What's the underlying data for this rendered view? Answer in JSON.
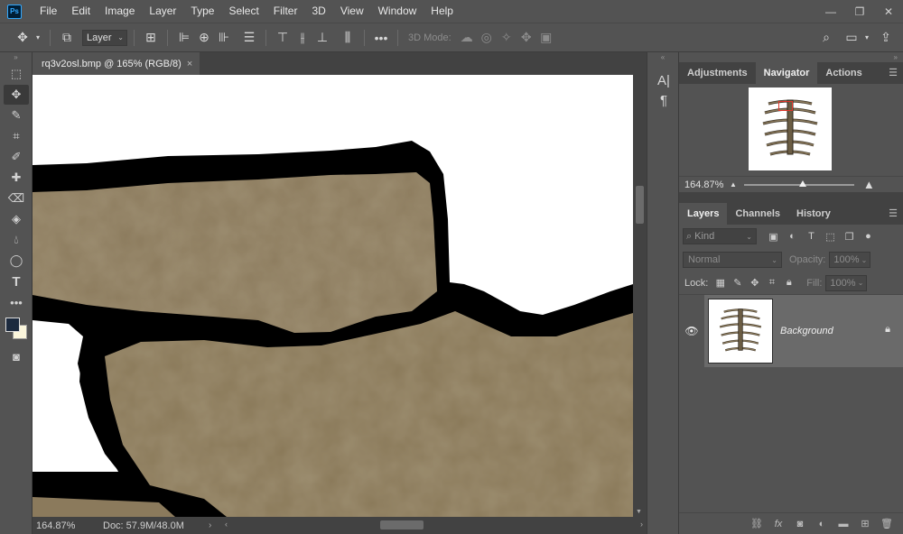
{
  "app": {
    "logo": "Ps"
  },
  "menu": [
    "File",
    "Edit",
    "Image",
    "Layer",
    "Type",
    "Select",
    "Filter",
    "3D",
    "View",
    "Window",
    "Help"
  ],
  "window_controls": {
    "minimize": "—",
    "restore": "❐",
    "close": "✕"
  },
  "options_bar": {
    "auto_select_target": "Layer",
    "mode_3d_label": "3D Mode:"
  },
  "document": {
    "tab_title": "rq3v2osl.bmp @ 165% (RGB/8)",
    "close_glyph": "×"
  },
  "status": {
    "zoom": "164.87%",
    "doc_size": "Doc: 57.9M/48.0M"
  },
  "panels": {
    "top_tabs": [
      "Adjustments",
      "Navigator",
      "Actions"
    ],
    "navigator": {
      "zoom": "164.87%"
    },
    "layers_tabs": [
      "Layers",
      "Channels",
      "History"
    ],
    "filter_kind": "Kind",
    "blend_mode": "Normal",
    "opacity_label": "Opacity:",
    "opacity_value": "100%",
    "lock_label": "Lock:",
    "fill_label": "Fill:",
    "fill_value": "100%",
    "layers": [
      {
        "name": "Background",
        "visible": true,
        "locked": true
      }
    ]
  },
  "colors": {
    "foreground": "#1c2a3e",
    "background": "#fbf6dc",
    "bone": "#8b7a5c",
    "outline": "#000000"
  },
  "icons": {
    "toolbar": [
      "marquee-icon",
      "move-icon",
      "quick-select-icon",
      "crop-icon",
      "brush-icon",
      "healing-icon",
      "eraser-icon",
      "paint-bucket-icon",
      "blur-icon",
      "ellipse-icon",
      "type-icon",
      "more-tools-icon"
    ]
  }
}
